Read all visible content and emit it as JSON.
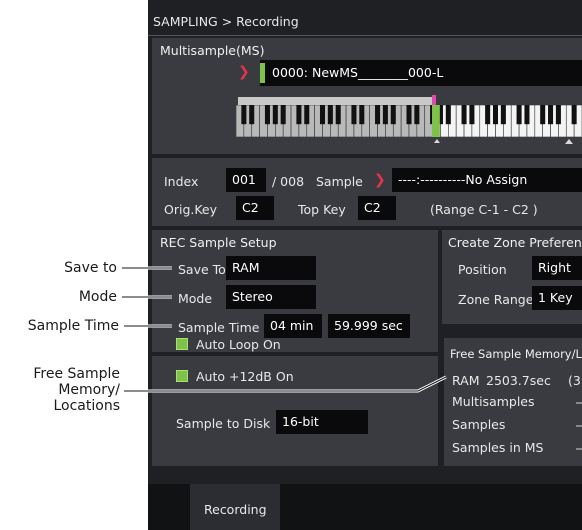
{
  "callouts": {
    "save_to": "Save to",
    "mode": "Mode",
    "sample_time": "Sample Time",
    "free_sample_line1": "Free Sample",
    "free_sample_line2": "Memory/",
    "free_sample_line3": "Locations"
  },
  "header": {
    "title": "SAMPLING > Recording"
  },
  "multisample": {
    "label": "Multisample(MS)",
    "name": "0000: NewMS________000-L"
  },
  "index_row": {
    "index_label": "Index",
    "index_value": "001",
    "index_sep": "/ 008",
    "sample_label": "Sample",
    "sample_value": "----:----------No Assign"
  },
  "key_row": {
    "orig_key_label": "Orig.Key",
    "orig_key_value": "C2",
    "top_key_label": "Top Key",
    "top_key_value": "C2",
    "range_text": "(Range  C-1   -  C2    )"
  },
  "rec_setup": {
    "title": "REC Sample Setup",
    "save_to_label": "Save To",
    "save_to_value": "RAM",
    "mode_label": "Mode",
    "mode_value": "Stereo",
    "sample_time_label": "Sample Time",
    "sample_time_min": "04 min",
    "sample_time_sec": "59.999 sec",
    "auto_loop_label": "Auto Loop On",
    "auto_12db_label": "Auto +12dB On",
    "sample_to_disk_label": "Sample to Disk",
    "sample_to_disk_value": "16-bit"
  },
  "zone_pref": {
    "title": "Create Zone Preferences",
    "position_label": "Position",
    "position_value": "Right",
    "zone_range_label": "Zone Range",
    "zone_range_value": "1 Key"
  },
  "free_mem": {
    "title": "Free Sample Memory/Locations",
    "ram_label": "RAM",
    "ram_value": "2503.7sec",
    "ram_extra": "(3",
    "multisamples_label": "Multisamples",
    "samples_label": "Samples",
    "samples_in_ms_label": "Samples in MS"
  },
  "tabs": {
    "recording": "Recording"
  },
  "colors": {
    "accent": "#e8324a",
    "check_green": "#7ec24a",
    "screen_bg": "#1f2024"
  }
}
